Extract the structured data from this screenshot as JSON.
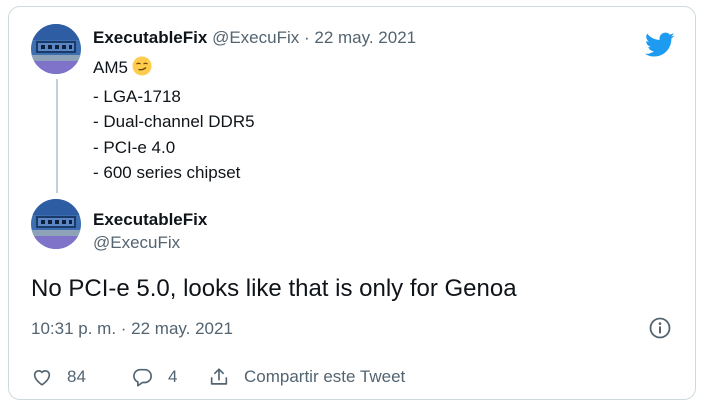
{
  "quoted_tweet": {
    "author_name": "ExecutableFix",
    "author_handle": "@ExecuFix",
    "separator": "·",
    "date": "22 may. 2021",
    "lines": [
      "AM5",
      "- LGA-1718",
      "- Dual-channel DDR5",
      "- PCI-e 4.0",
      "- 600 series chipset"
    ],
    "emoji": "smirking-face"
  },
  "tweet": {
    "author_name": "ExecutableFix",
    "author_handle": "@ExecuFix",
    "text": "No PCI-e 5.0, looks like that is only for Genoa",
    "timestamp": "10:31 p. m. · 22 may. 2021"
  },
  "actions": {
    "like_count": "84",
    "reply_count": "4",
    "share_label": "Compartir este Tweet"
  },
  "colors": {
    "brand": "#1d9bf0",
    "text_primary": "#0f1419",
    "text_secondary": "#536471",
    "border": "#cfd9de"
  },
  "icons": [
    "twitter-bird-icon",
    "info-icon",
    "heart-icon",
    "reply-icon",
    "share-icon"
  ]
}
